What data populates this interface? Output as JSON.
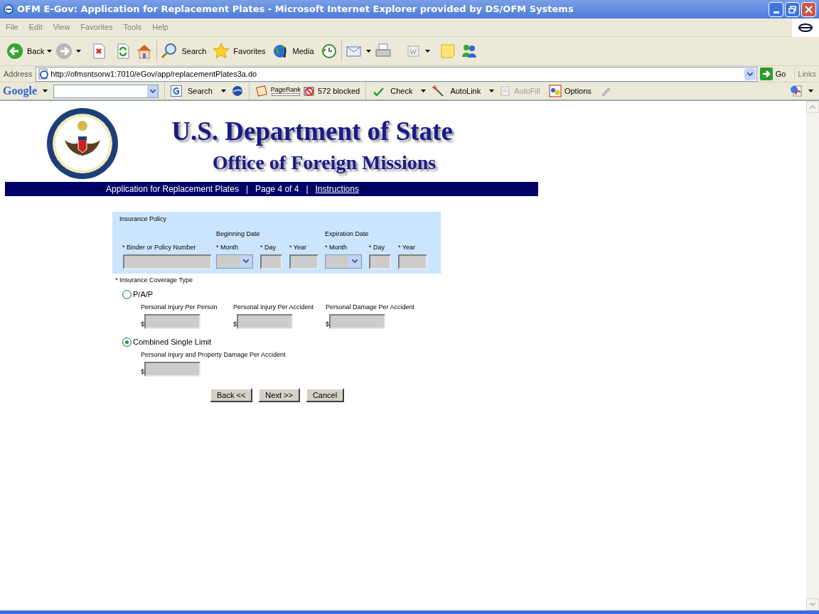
{
  "window": {
    "title": "OFM E-Gov: Application for Replacement Plates - Microsoft Internet Explorer provided by DS/OFM Systems"
  },
  "menu": [
    "File",
    "Edit",
    "View",
    "Favorites",
    "Tools",
    "Help"
  ],
  "toolbar": {
    "back": "Back",
    "search": "Search",
    "favorites": "Favorites",
    "media": "Media"
  },
  "address": {
    "label": "Address",
    "url": "http://ofmsntsorw1:7010/eGov/app/replacementPlates3a.do",
    "go": "Go",
    "links": "Links"
  },
  "google_bar": {
    "logo": "Google",
    "search": "Search",
    "pagerank": "PageRank",
    "blocked": "572 blocked",
    "check": "Check",
    "autolink": "AutoLink",
    "autofill": "AutoFill",
    "options": "Options"
  },
  "header": {
    "title": "U.S. Department of State",
    "subtitle": "Office of Foreign Missions"
  },
  "nav": [
    {
      "kind": "text",
      "text": "Application for Replacement Plates"
    },
    {
      "kind": "separator",
      "text": "|"
    },
    {
      "kind": "text",
      "text": "Page 4 of 4"
    },
    {
      "kind": "separator",
      "text": "|"
    },
    {
      "kind": "link",
      "text": "Instructions"
    }
  ],
  "policy": {
    "title": "Insurance Policy",
    "number_label": "* Binder or Policy Number",
    "dates": [
      {
        "title": "Beginning Date",
        "month": "* Month",
        "day": "* Day",
        "year": "* Year"
      },
      {
        "title": "Expiration Date",
        "month": "* Month",
        "day": "* Day",
        "year": "* Year"
      }
    ]
  },
  "coverage": {
    "label": "* Insurance Coverage Type",
    "currency": "$",
    "options": [
      {
        "label": "P/A/P",
        "selected": false,
        "fields": [
          "Personal Injury Per Person",
          "Personal Injury Per Accident",
          "Personal Damage Per Accident"
        ]
      },
      {
        "label": "Combined Single Limit",
        "selected": true,
        "fields": [
          "Personal Injury and Property Damage Per Accident"
        ]
      }
    ]
  },
  "buttons": [
    "Back <<",
    "Next >>",
    "Cancel"
  ]
}
